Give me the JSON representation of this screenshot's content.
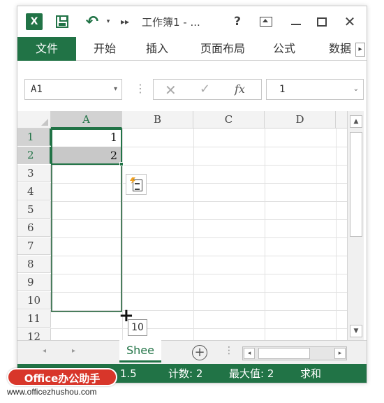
{
  "titlebar": {
    "app_logo": "X",
    "title": "工作簿1 - ...",
    "help": "?",
    "close": "✕",
    "undo_glyph": "↶",
    "undo_drop": "▾",
    "more": "▸▸"
  },
  "ribbon": {
    "tabs": [
      "文件",
      "开始",
      "插入",
      "页面布局",
      "公式",
      "数据"
    ],
    "scroll_glyph": "▸"
  },
  "formula_bar": {
    "name_box": "A1",
    "dots": "⋮",
    "cancel_glyph": "✕",
    "enter_glyph": "✓",
    "fx": "fx",
    "value": "1",
    "drop_glyph": "▾",
    "expand_glyph": "⌄"
  },
  "grid": {
    "columns": [
      "A",
      "B",
      "C",
      "D"
    ],
    "rows": [
      "1",
      "2",
      "3",
      "4",
      "5",
      "6",
      "7",
      "8",
      "9",
      "10",
      "11",
      "12"
    ],
    "cells": {
      "A1": "1",
      "A2": "2"
    },
    "fill_tooltip": "10",
    "cursor": "+"
  },
  "scroll": {
    "up": "▲",
    "down": "▼",
    "left": "◂",
    "right": "▸"
  },
  "sheetbar": {
    "prev": "◂",
    "next": "▸",
    "active_sheet": "Shee",
    "add_sheet": "+",
    "dots": "⋮"
  },
  "statusbar": {
    "average": "值: 1.5",
    "count": "计数: 2",
    "max": "最大值: 2",
    "sum": "求和"
  },
  "watermark": {
    "badge": "Office办公助手",
    "url": "www.officezhushou.com"
  },
  "colors": {
    "accent": "#217346",
    "watermark_red": "#d8362a"
  }
}
